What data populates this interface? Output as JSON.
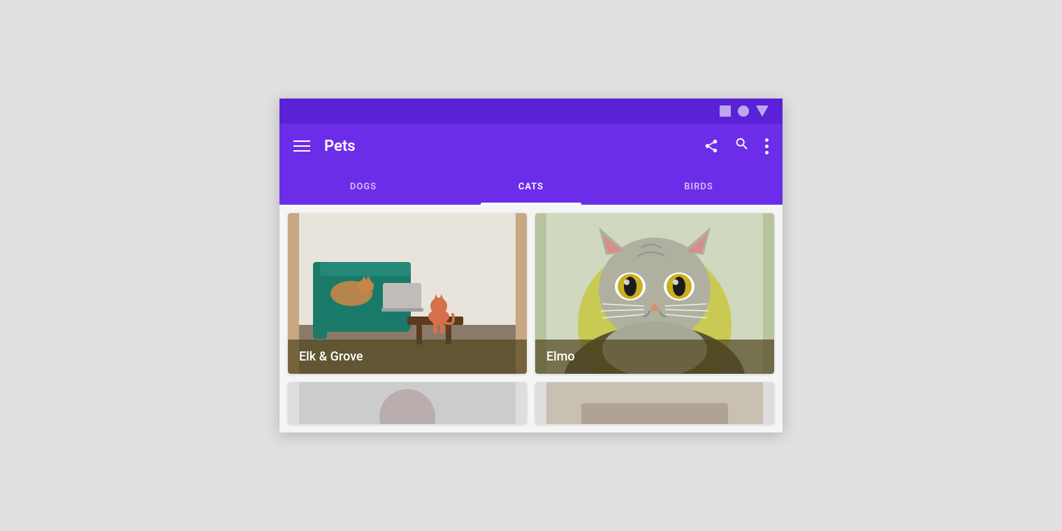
{
  "statusBar": {
    "icons": [
      "square",
      "circle",
      "triangle"
    ]
  },
  "appBar": {
    "title": "Pets",
    "actions": [
      "share",
      "search",
      "more"
    ]
  },
  "tabs": [
    {
      "label": "DOGS",
      "active": false
    },
    {
      "label": "CATS",
      "active": true
    },
    {
      "label": "BIRDS",
      "active": false
    }
  ],
  "cards": [
    {
      "id": "elk-grove",
      "label": "Elk & Grove",
      "bgColor": "#c8a882"
    },
    {
      "id": "elmo",
      "label": "Elmo",
      "bgColor": "#b8c4a0"
    }
  ],
  "colors": {
    "primary": "#6c2de9",
    "statusBar": "#5b21d6",
    "activeTab": "#ffffff",
    "inactiveTab": "rgba(255,255,255,0.7)"
  }
}
